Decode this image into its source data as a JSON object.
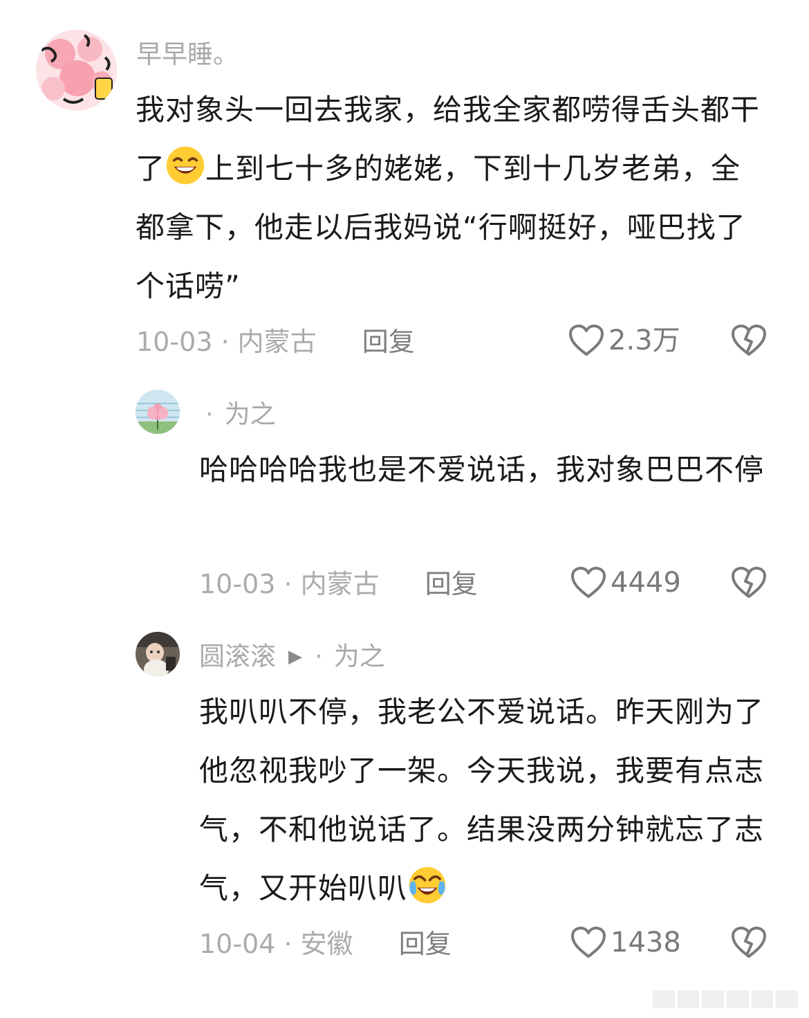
{
  "comments": [
    {
      "username": "早早睡。",
      "text_parts": [
        "我对象头一回去我家，给我全家都唠得舌头都干了",
        "上到七十多的姥姥，下到十几岁老弟，全都拿下，他走以后我妈说“行啊挺好，哑巴找了个话唠”"
      ],
      "emoji": "grinning-face-emoji",
      "date_location": "10-03 · 内蒙古",
      "reply_label": "回复",
      "likes": "2.3万"
    },
    {
      "reply_dot": "·",
      "reply_to": "为之",
      "text": "哈哈哈哈我也是不爱说话，我对象巴巴不停",
      "date_location": "10-03 · 内蒙古",
      "reply_label": "回复",
      "likes": "4449"
    },
    {
      "username": "圆滚滚",
      "reply_dot": "·",
      "reply_to": "为之",
      "text": "我叭叭不停，我老公不爱说话。昨天刚为了他忽视我吵了一架。今天我说，我要有点志气，不和他说话了。结果没两分钟就忘了志气，又开始叭叭",
      "emoji": "tears-of-joy-emoji",
      "date_location": "10-04 · 安徽",
      "reply_label": "回复",
      "likes": "1438"
    }
  ],
  "colors": {
    "text": "#1a1a1a",
    "meta": "#ababab",
    "icon": "#7a7a7a"
  }
}
